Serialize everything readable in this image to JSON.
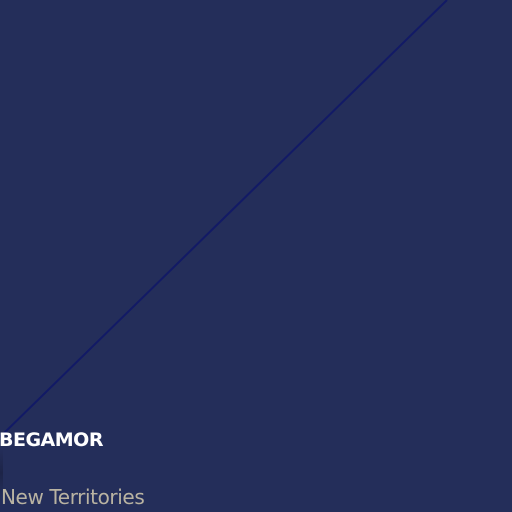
{
  "map": {
    "background_color": "#242e5a",
    "route_color": "#121a66",
    "place": {
      "name": "BEGAMOR",
      "region": "New Territories"
    }
  }
}
